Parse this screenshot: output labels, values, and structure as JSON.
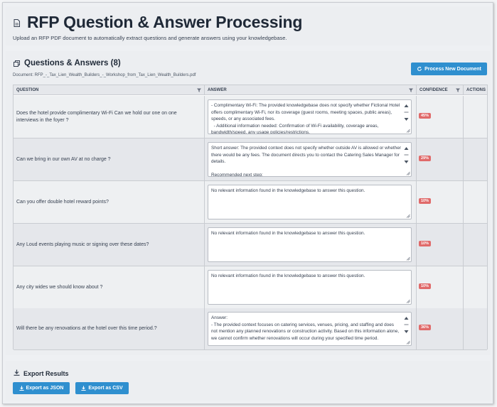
{
  "header": {
    "title": "RFP Question & Answer Processing",
    "subtitle": "Upload an RFP PDF document to automatically extract questions and generate answers using your knowledgebase.",
    "icon": "document-icon"
  },
  "qa": {
    "title": "Questions & Answers (8)",
    "document_label": "Document: RFP_-_Tax_Lien_Wealth_Builders_-_Workshop_from_Tax_Lien_Wealth_Builders.pdf",
    "process_button": "Process New Document",
    "columns": {
      "question": "QUESTION",
      "answer": "ANSWER",
      "confidence": "CONFIDENCE",
      "actions": "ACTIONS"
    },
    "rows": [
      {
        "question": "Does the hotel provide complimentary Wi-Fi Can we hold our one on one interviews in the foyer ?",
        "answer": "- Complimentary Wi-Fi: The provided knowledgebase does not specify whether Fictional Hotel offers complimentary Wi-Fi, nor its coverage (guest rooms, meeting spaces, public areas), speeds, or any associated fees.\n  - Additional information needed: Confirmation of Wi-Fi availability, coverage areas, bandwidth/speed, any usage policies/restrictions.",
        "confidence": "45%"
      },
      {
        "question": "Can we bring in our own AV at no charge ?",
        "answer": "Short answer: The provided context does not specify whether outside AV is allowed or whether there would be any fees. The document directs you to contact the Catering Sales Manager for details.\n\nRecommended next step:",
        "confidence": "29%"
      },
      {
        "question": "Can you offer double hotel reward points?",
        "answer": "No relevant information found in the knowledgebase to answer this question.",
        "confidence": "10%"
      },
      {
        "question": "Any Loud events playing music or signing over these dates?",
        "answer": "No relevant information found in the knowledgebase to answer this question.",
        "confidence": "10%"
      },
      {
        "question": "Any city wides we should know about ?",
        "answer": "No relevant information found in the knowledgebase to answer this question.",
        "confidence": "10%"
      },
      {
        "question": "Will there be any renovations at the hotel over this time period.?",
        "answer": "Answer:\n- The provided context focuses on catering services, venues, pricing, and staffing and does not mention any planned renovations or construction activity. Based on this information alone, we cannot confirm whether renovations will occur during your specified time period.",
        "confidence": "36%"
      }
    ]
  },
  "export": {
    "title": "Export Results",
    "json_button": "Export as JSON",
    "csv_button": "Export as CSV"
  },
  "colors": {
    "accent": "#2f8fcf",
    "badge": "#e06a6a"
  }
}
